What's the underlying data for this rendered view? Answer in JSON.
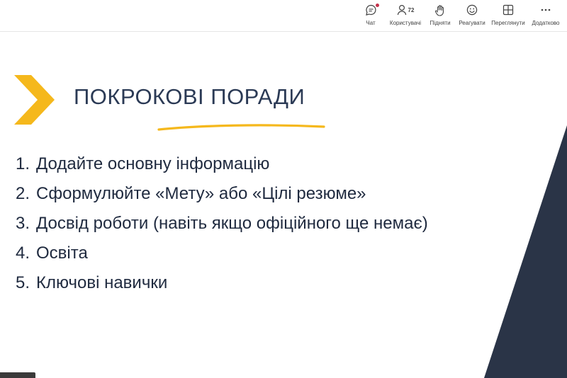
{
  "toolbar": {
    "items": [
      {
        "label": "Чат",
        "icon": "chat-icon",
        "notification": true
      },
      {
        "label": "Користувачі",
        "icon": "people-icon",
        "count": "72"
      },
      {
        "label": "Підняти",
        "icon": "raise-hand-icon"
      },
      {
        "label": "Реагувати",
        "icon": "react-icon"
      },
      {
        "label": "Переглянути",
        "icon": "view-grid-icon"
      },
      {
        "label": "Додатково",
        "icon": "more-icon"
      }
    ]
  },
  "slide": {
    "title": "ПОКРОКОВІ ПОРАДИ",
    "items": [
      {
        "number": "1.",
        "text": "Додайте основну інформацію"
      },
      {
        "number": "2.",
        "text": "Сформулюйте «Мету» або «Цілі резюме»"
      },
      {
        "number": "3.",
        "text": "Досвід роботи (навіть якщо офіційного ще немає)"
      },
      {
        "number": "4.",
        "text": "Освіта"
      },
      {
        "number": "5.",
        "text": "Ключові навички"
      }
    ]
  },
  "colors": {
    "accent_yellow": "#f5b81c",
    "title_navy": "#2b3a55",
    "dark_shape": "#2a3447",
    "notification_red": "#c4314b"
  }
}
